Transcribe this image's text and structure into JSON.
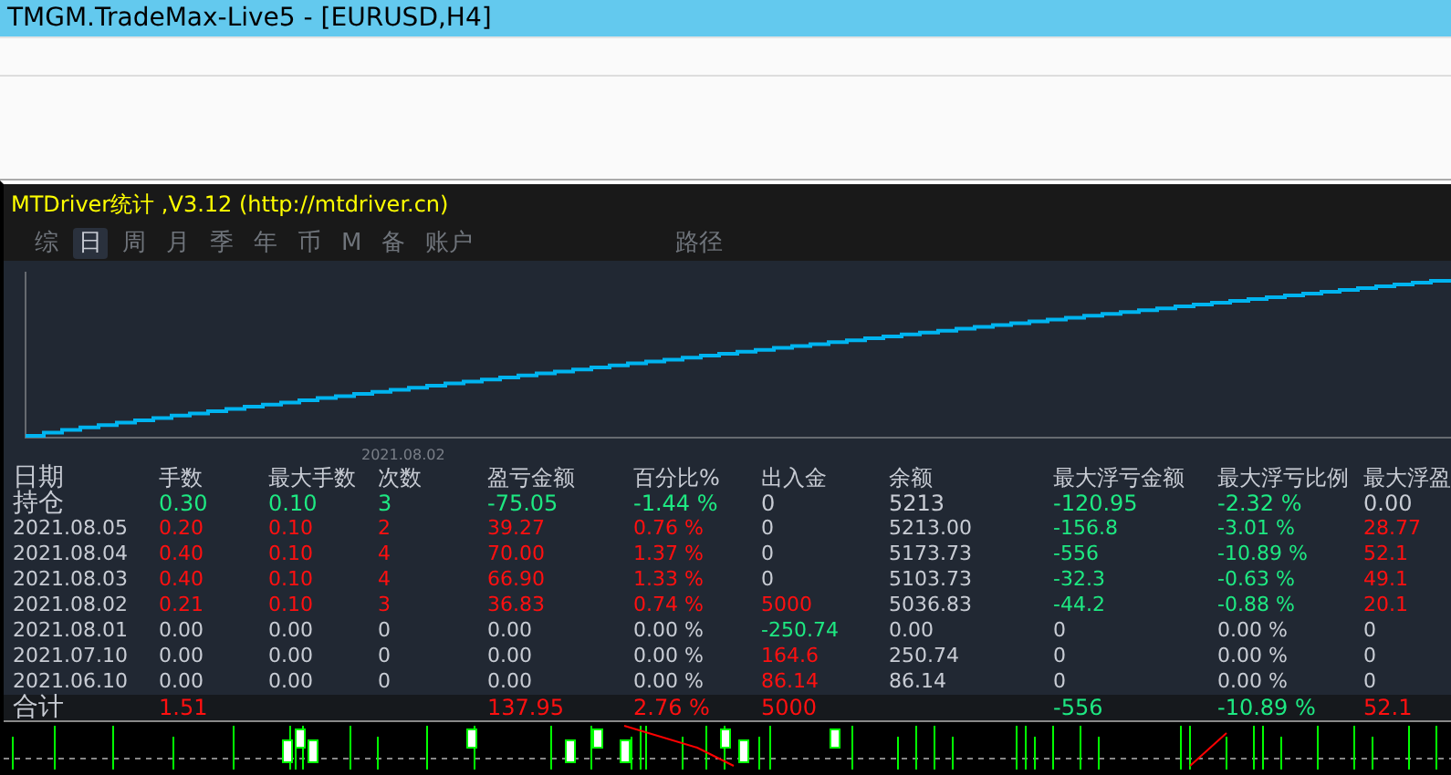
{
  "window": {
    "title": "TMGM.TradeMax-Live5 - [EURUSD,H4]"
  },
  "panel": {
    "title": "MTDriver统计 ,V3.12 (http://mtdriver.cn)",
    "tabs": [
      {
        "label": "综",
        "selected": false
      },
      {
        "label": "日",
        "selected": true
      },
      {
        "label": "周",
        "selected": false
      },
      {
        "label": "月",
        "selected": false
      },
      {
        "label": "季",
        "selected": false
      },
      {
        "label": "年",
        "selected": false
      },
      {
        "label": "币",
        "selected": false
      },
      {
        "label": "M",
        "selected": false
      },
      {
        "label": "备",
        "selected": false
      },
      {
        "label": "账户",
        "selected": false
      }
    ],
    "path_tab": {
      "label": "路径",
      "selected": false
    },
    "equity_chart": {
      "kind": "picture",
      "x_label": "2021.08.02"
    },
    "table": {
      "columns": [
        "日期",
        "手数",
        "最大手数",
        "次数",
        "盈亏金额",
        "百分比%",
        "出入金",
        "余额",
        "最大浮亏金额",
        "最大浮亏比例",
        "最大浮盈"
      ],
      "rows": [
        {
          "kind": "position",
          "cells": [
            {
              "text": "持仓",
              "color": "#c8ccd4"
            },
            {
              "text": "0.30",
              "color": "#1ee882"
            },
            {
              "text": "0.10",
              "color": "#1ee882"
            },
            {
              "text": "3",
              "color": "#1ee882"
            },
            {
              "text": "-75.05",
              "color": "#1ee882"
            },
            {
              "text": "-1.44 %",
              "color": "#1ee882"
            },
            {
              "text": "0",
              "color": "#c8ccd4"
            },
            {
              "text": "5213",
              "color": "#c8ccd4"
            },
            {
              "text": "-120.95",
              "color": "#1ee882"
            },
            {
              "text": "-2.32 %",
              "color": "#1ee882"
            },
            {
              "text": "0.00",
              "color": "#c8ccd4"
            }
          ]
        },
        {
          "kind": "day",
          "cells": [
            {
              "text": "2021.08.05",
              "color": "#c8ccd4"
            },
            {
              "text": "0.20",
              "color": "#ff1010"
            },
            {
              "text": "0.10",
              "color": "#ff1010"
            },
            {
              "text": "2",
              "color": "#ff1010"
            },
            {
              "text": "39.27",
              "color": "#ff1010"
            },
            {
              "text": "0.76 %",
              "color": "#ff1010"
            },
            {
              "text": "0",
              "color": "#c8ccd4"
            },
            {
              "text": "5213.00",
              "color": "#c8ccd4"
            },
            {
              "text": "-156.8",
              "color": "#1ee882"
            },
            {
              "text": "-3.01 %",
              "color": "#1ee882"
            },
            {
              "text": "28.77",
              "color": "#ff1010"
            }
          ]
        },
        {
          "kind": "day",
          "cells": [
            {
              "text": "2021.08.04",
              "color": "#c8ccd4"
            },
            {
              "text": "0.40",
              "color": "#ff1010"
            },
            {
              "text": "0.10",
              "color": "#ff1010"
            },
            {
              "text": "4",
              "color": "#ff1010"
            },
            {
              "text": "70.00",
              "color": "#ff1010"
            },
            {
              "text": "1.37 %",
              "color": "#ff1010"
            },
            {
              "text": "0",
              "color": "#c8ccd4"
            },
            {
              "text": "5173.73",
              "color": "#c8ccd4"
            },
            {
              "text": "-556",
              "color": "#1ee882"
            },
            {
              "text": "-10.89 %",
              "color": "#1ee882"
            },
            {
              "text": "52.1",
              "color": "#ff1010"
            }
          ]
        },
        {
          "kind": "day",
          "cells": [
            {
              "text": "2021.08.03",
              "color": "#c8ccd4"
            },
            {
              "text": "0.40",
              "color": "#ff1010"
            },
            {
              "text": "0.10",
              "color": "#ff1010"
            },
            {
              "text": "4",
              "color": "#ff1010"
            },
            {
              "text": "66.90",
              "color": "#ff1010"
            },
            {
              "text": "1.33 %",
              "color": "#ff1010"
            },
            {
              "text": "0",
              "color": "#c8ccd4"
            },
            {
              "text": "5103.73",
              "color": "#c8ccd4"
            },
            {
              "text": "-32.3",
              "color": "#1ee882"
            },
            {
              "text": "-0.63 %",
              "color": "#1ee882"
            },
            {
              "text": "49.1",
              "color": "#ff1010"
            }
          ]
        },
        {
          "kind": "day",
          "cells": [
            {
              "text": "2021.08.02",
              "color": "#c8ccd4"
            },
            {
              "text": "0.21",
              "color": "#ff1010"
            },
            {
              "text": "0.10",
              "color": "#ff1010"
            },
            {
              "text": "3",
              "color": "#ff1010"
            },
            {
              "text": "36.83",
              "color": "#ff1010"
            },
            {
              "text": "0.74 %",
              "color": "#ff1010"
            },
            {
              "text": "5000",
              "color": "#ff1010"
            },
            {
              "text": "5036.83",
              "color": "#c8ccd4"
            },
            {
              "text": "-44.2",
              "color": "#1ee882"
            },
            {
              "text": "-0.88 %",
              "color": "#1ee882"
            },
            {
              "text": "20.1",
              "color": "#ff1010"
            }
          ]
        },
        {
          "kind": "day",
          "cells": [
            {
              "text": "2021.08.01",
              "color": "#c8ccd4"
            },
            {
              "text": "0.00",
              "color": "#c8ccd4"
            },
            {
              "text": "0.00",
              "color": "#c8ccd4"
            },
            {
              "text": "0",
              "color": "#c8ccd4"
            },
            {
              "text": "0.00",
              "color": "#c8ccd4"
            },
            {
              "text": "0.00 %",
              "color": "#c8ccd4"
            },
            {
              "text": "-250.74",
              "color": "#1ee882"
            },
            {
              "text": "0.00",
              "color": "#c8ccd4"
            },
            {
              "text": "0",
              "color": "#c8ccd4"
            },
            {
              "text": "0.00 %",
              "color": "#c8ccd4"
            },
            {
              "text": "0",
              "color": "#c8ccd4"
            }
          ]
        },
        {
          "kind": "day",
          "cells": [
            {
              "text": "2021.07.10",
              "color": "#c8ccd4"
            },
            {
              "text": "0.00",
              "color": "#c8ccd4"
            },
            {
              "text": "0.00",
              "color": "#c8ccd4"
            },
            {
              "text": "0",
              "color": "#c8ccd4"
            },
            {
              "text": "0.00",
              "color": "#c8ccd4"
            },
            {
              "text": "0.00 %",
              "color": "#c8ccd4"
            },
            {
              "text": "164.6",
              "color": "#ff1010"
            },
            {
              "text": "250.74",
              "color": "#c8ccd4"
            },
            {
              "text": "0",
              "color": "#c8ccd4"
            },
            {
              "text": "0.00 %",
              "color": "#c8ccd4"
            },
            {
              "text": "0",
              "color": "#c8ccd4"
            }
          ]
        },
        {
          "kind": "day",
          "cells": [
            {
              "text": "2021.06.10",
              "color": "#c8ccd4"
            },
            {
              "text": "0.00",
              "color": "#c8ccd4"
            },
            {
              "text": "0.00",
              "color": "#c8ccd4"
            },
            {
              "text": "0",
              "color": "#c8ccd4"
            },
            {
              "text": "0.00",
              "color": "#c8ccd4"
            },
            {
              "text": "0.00 %",
              "color": "#c8ccd4"
            },
            {
              "text": "86.14",
              "color": "#ff1010"
            },
            {
              "text": "86.14",
              "color": "#c8ccd4"
            },
            {
              "text": "0",
              "color": "#c8ccd4"
            },
            {
              "text": "0.00 %",
              "color": "#c8ccd4"
            },
            {
              "text": "0",
              "color": "#c8ccd4"
            }
          ]
        }
      ],
      "totals": {
        "label": {
          "text": "合计",
          "color": "#c8ccd4"
        },
        "lots": {
          "text": "1.51",
          "color": "#ff1010"
        },
        "profit": {
          "text": "137.95",
          "color": "#ff1010"
        },
        "percent": {
          "text": "2.76 %",
          "color": "#ff1010"
        },
        "deposit": {
          "text": "5000",
          "color": "#ff1010"
        },
        "max_float_loss": {
          "text": "-556",
          "color": "#1ee882"
        },
        "max_float_loss_ratio": {
          "text": "-10.89 %",
          "color": "#1ee882"
        },
        "max_float_profit": {
          "text": "52.1",
          "color": "#ff1010"
        }
      }
    }
  }
}
